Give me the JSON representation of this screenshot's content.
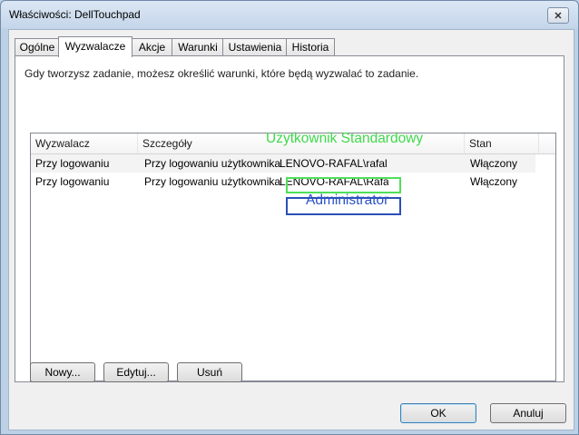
{
  "window": {
    "title": "Właściwości: DellTouchpad",
    "close_glyph": "✕"
  },
  "tabs": [
    {
      "label": "Ogólne"
    },
    {
      "label": "Wyzwalacze",
      "active": true
    },
    {
      "label": "Akcje"
    },
    {
      "label": "Warunki"
    },
    {
      "label": "Ustawienia"
    },
    {
      "label": "Historia"
    }
  ],
  "panel": {
    "description": "Gdy tworzysz zadanie, możesz określić warunki, które będą wyzwalać to zadanie."
  },
  "list": {
    "columns": [
      "Wyzwalacz",
      "Szczegóły",
      "Stan"
    ],
    "rows": [
      {
        "trigger": "Przy logowaniu",
        "details": "Przy logowaniu użytkownika",
        "user": "LENOVO-RAFAL\\rafal",
        "status": "Włączony"
      },
      {
        "trigger": "Przy logowaniu",
        "details": "Przy logowaniu użytkownika",
        "user": "LENOVO-RAFAL\\Rafał",
        "status": "Włączony"
      }
    ]
  },
  "annotations": {
    "standard_user": "Użytkownik Standardowy",
    "admin": "Administrator",
    "standard_color": "#3ed94a",
    "admin_color": "#2c53c7"
  },
  "buttons": {
    "new": "Nowy...",
    "edit": "Edytuj...",
    "delete": "Usuń",
    "ok": "OK",
    "cancel": "Anuluj"
  }
}
